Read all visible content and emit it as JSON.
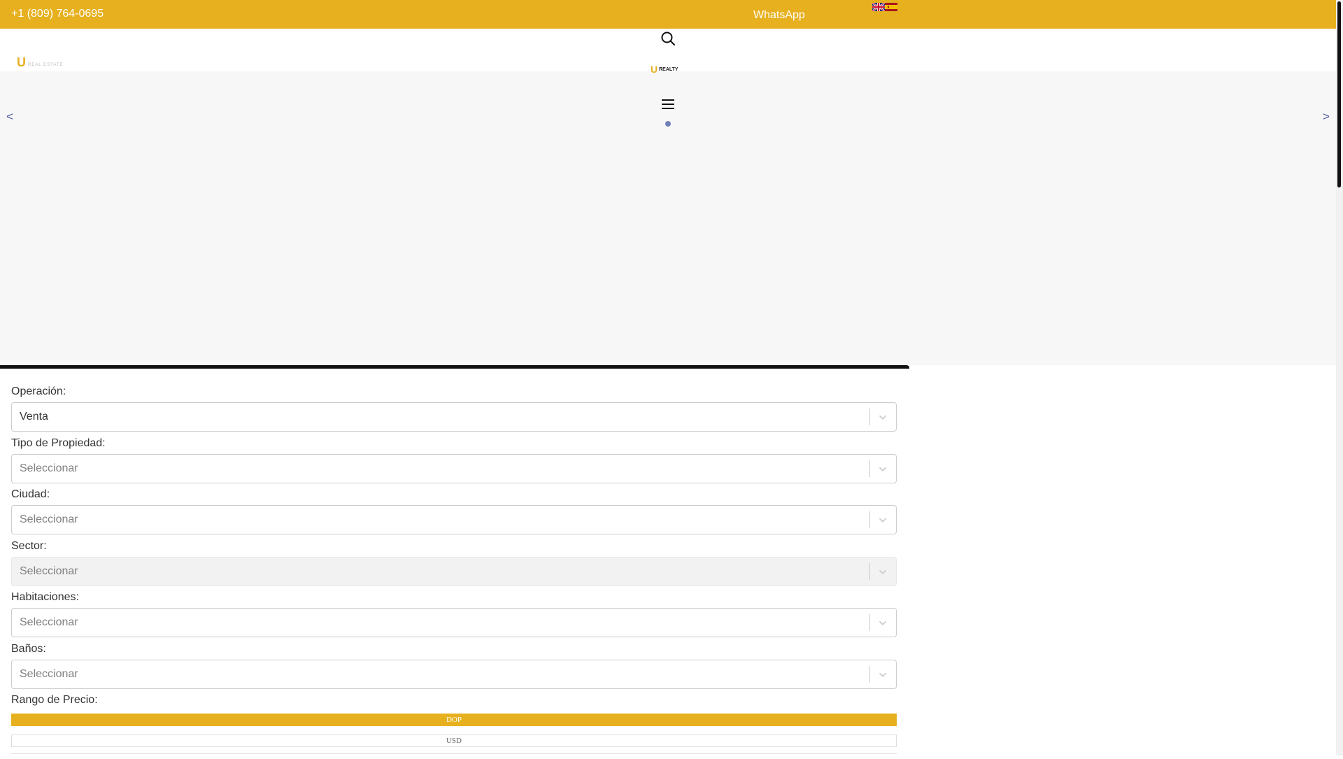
{
  "topbar": {
    "phone": "+1 (809) 764-0695",
    "whatsapp": "WhatsApp",
    "color": "#e6b01e",
    "languages": [
      "English",
      "Español"
    ]
  },
  "header": {
    "search_icon": "search-icon",
    "menu_icon": "hamburger-menu-icon",
    "logo_letter": "U",
    "logo_text": "REAL ESTATE",
    "center_logo_text": "REALTY"
  },
  "slider": {
    "prev": "<",
    "next": ">"
  },
  "form": {
    "fields": [
      {
        "label": "Operación:",
        "value": "Venta",
        "placeholder": ""
      },
      {
        "label": "Tipo de Propiedad:",
        "value": "",
        "placeholder": "Seleccionar"
      },
      {
        "label": "Ciudad:",
        "value": "",
        "placeholder": "Seleccionar"
      },
      {
        "label": "Sector:",
        "value": "",
        "placeholder": "Seleccionar",
        "disabled": true
      },
      {
        "label": "Habitaciones:",
        "value": "",
        "placeholder": "Seleccionar"
      },
      {
        "label": "Baños:",
        "value": "",
        "placeholder": "Seleccionar"
      }
    ],
    "price_label": "Rango de Precio:",
    "currencies": [
      "DOP",
      "USD"
    ],
    "selected_currency": "DOP"
  }
}
